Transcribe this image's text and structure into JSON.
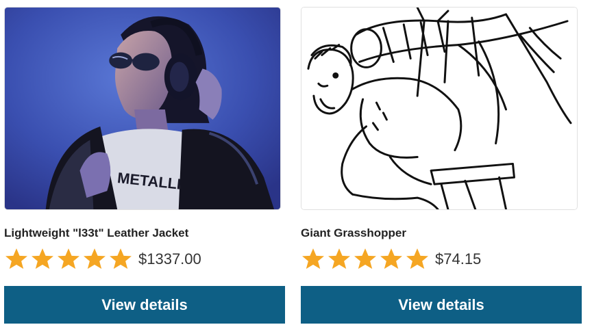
{
  "products": [
    {
      "title": "Lightweight \"l33t\" Leather Jacket",
      "price": "$1337.00",
      "rating": 5,
      "button_label": "View details",
      "image": "woman-with-headphones-photo"
    },
    {
      "title": "Giant Grasshopper",
      "price": "$74.15",
      "rating": 5,
      "button_label": "View details",
      "image": "grasshopper-sketch-drawing"
    }
  ],
  "colors": {
    "star": "#f5a623",
    "button": "#0e5f85",
    "button_text": "#ffffff",
    "title": "#222222",
    "price": "#333333"
  }
}
